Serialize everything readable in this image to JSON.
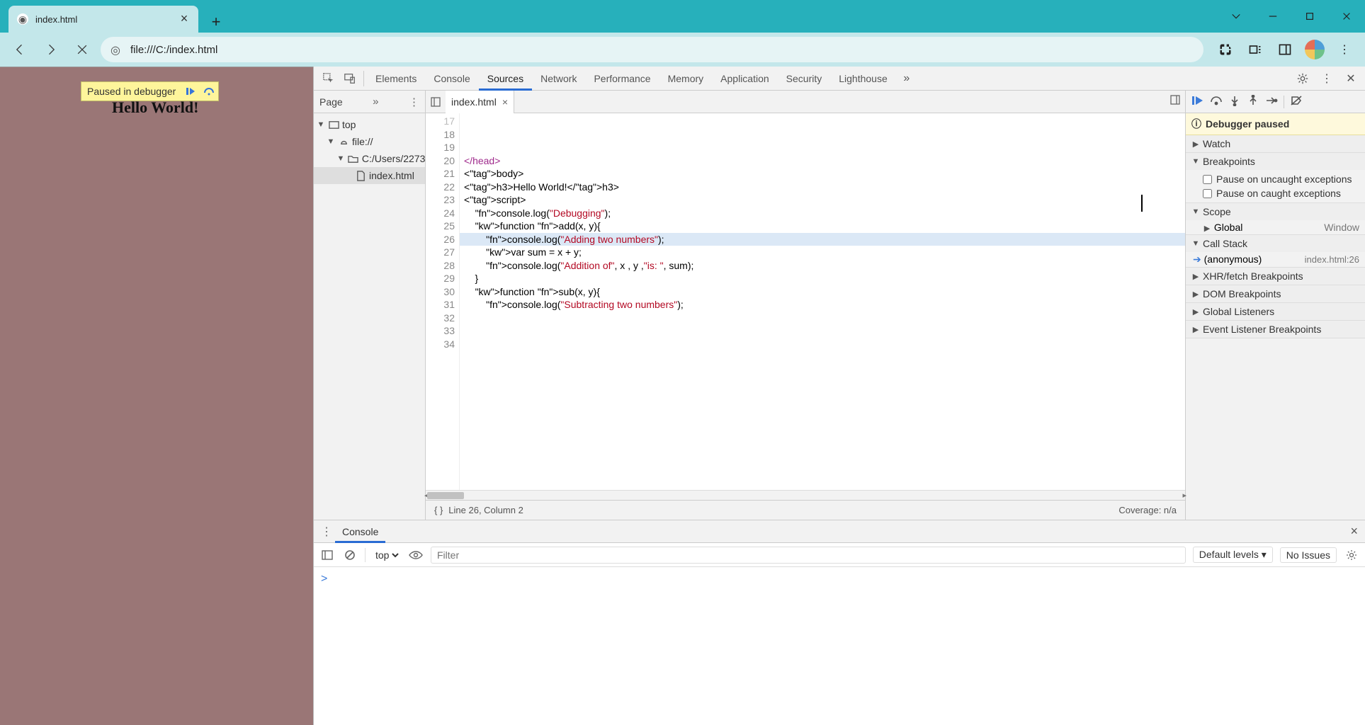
{
  "browser": {
    "tab_title": "index.html",
    "url": "file:///C:/index.html"
  },
  "page": {
    "paused_label": "Paused in debugger",
    "heading": "Hello World!"
  },
  "devtools_tabs": [
    "Elements",
    "Console",
    "Sources",
    "Network",
    "Performance",
    "Memory",
    "Application",
    "Security",
    "Lighthouse"
  ],
  "devtools_active_tab": "Sources",
  "navigator": {
    "header": "Page",
    "tree": {
      "top": "top",
      "scheme": "file://",
      "folder": "C:/Users/2273",
      "file": "index.html"
    }
  },
  "editor": {
    "open_file": "index.html",
    "first_line_no": 18,
    "highlighted_line_no": 26,
    "lines": [
      "</head>",
      "",
      "<body>",
      "<h3>Hello World!</h3>",
      "",
      "",
      "",
      "",
      "<script>",
      "    console.log(\"Debugging\");",
      "    function add(x, y){",
      "        console.log(\"Adding two numbers\");",
      "        var sum = x + y;",
      "        console.log(\"Addition of\", x , y ,\"is: \", sum);",
      "    }",
      "",
      "    function sub(x, y){",
      "        console.log(\"Subtracting two numbers\");"
    ],
    "status_line_col": "Line 26, Column 2",
    "coverage": "Coverage: n/a"
  },
  "debugger": {
    "banner": "Debugger paused",
    "sections": {
      "watch": "Watch",
      "breakpoints": "Breakpoints",
      "bp_uncaught": "Pause on uncaught exceptions",
      "bp_caught": "Pause on caught exceptions",
      "scope": "Scope",
      "scope_global": "Global",
      "scope_global_val": "Window",
      "callstack": "Call Stack",
      "frame_name": "(anonymous)",
      "frame_loc": "index.html:26",
      "xhr": "XHR/fetch Breakpoints",
      "dom": "DOM Breakpoints",
      "glisten": "Global Listeners",
      "evlisten": "Event Listener Breakpoints"
    }
  },
  "console": {
    "tab": "Console",
    "context": "top",
    "filter_placeholder": "Filter",
    "levels": "Default levels",
    "issues": "No Issues",
    "prompt": ">"
  }
}
